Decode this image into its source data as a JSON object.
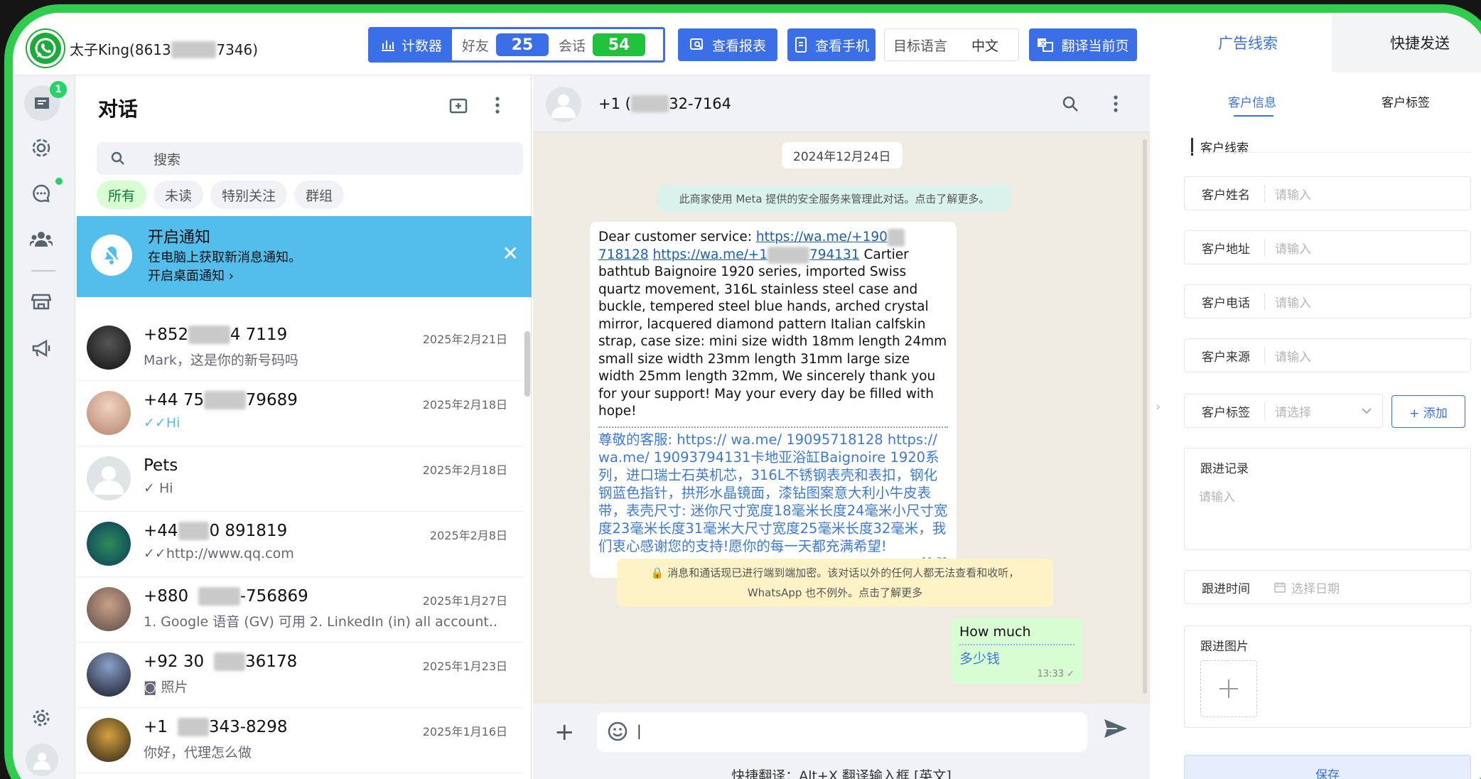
{
  "app": {
    "account": "太子King(8613",
    "account_suffix": "7346)"
  },
  "toolbar": {
    "counter_label": "计数器",
    "friends_label": "好友",
    "friends_count": "25",
    "sessions_label": "会话",
    "sessions_count": "54",
    "report_label": "查看报表",
    "phone_label": "查看手机",
    "target_lang_label": "目标语言",
    "target_lang_value": "中文",
    "translate_label": "翻译当前页"
  },
  "rail": {
    "badge": "1"
  },
  "list": {
    "title": "对话",
    "search_placeholder": "搜索",
    "filters": [
      "所有",
      "未读",
      "特别关注",
      "群组"
    ],
    "notify": {
      "title": "开启通知",
      "line1": "在电脑上获取新消息通知。",
      "line2": "开启桌面通知 ›"
    },
    "chats": [
      {
        "name_a": "+852",
        "name_b": "4 7119",
        "date": "2025年2月21日",
        "preview": "Mark，这是你的新号码吗"
      },
      {
        "name_a": "+44 75",
        "name_b": "79689",
        "date": "2025年2月18日",
        "preview": "✓✓Hi"
      },
      {
        "name_a": "Pets",
        "name_b": "",
        "date": "2025年2月18日",
        "preview": "✓ Hi"
      },
      {
        "name_a": "+44",
        "name_b": "0 891819",
        "date": "2025年2月8日",
        "preview": "✓✓http://www.qq.com"
      },
      {
        "name_a": "+880",
        "name_b": "-756869",
        "date": "2025年1月27日",
        "preview": "1. Google 语音 (GV) 可用 2.  LinkedIn (in) all account..."
      },
      {
        "name_a": "+92 30",
        "name_b": "36178",
        "date": "2025年1月23日",
        "preview": "◙ 照片"
      },
      {
        "name_a": "+1",
        "name_b": "343-8298",
        "date": "2025年1月16日",
        "preview": "你好，代理怎么做"
      }
    ]
  },
  "conversation": {
    "contact_a": "+1 (",
    "contact_b": "32-7164",
    "date": "2024年12月24日",
    "meta_notice": "此商家使用 Meta 提供的安全服务来管理此对话。点击了解更多。",
    "incoming": {
      "prefix": "Dear customer service: ",
      "link1_a": "https://wa.me/+190",
      "link1_b": "718128",
      "link2_a": "https://wa.me/+1",
      "link2_b": "794131",
      "body": " Cartier bathtub Baignoire 1920 series, imported Swiss quartz movement, 316L stainless steel case and buckle, tempered steel blue hands, arched crystal mirror, lacquered diamond pattern Italian calfskin strap, case size: mini size width 18mm length 24mm small size width 23mm length 31mm large size width 25mm length 32mm, We sincerely thank you for your support! May your every day be filled with hope!",
      "translation": "尊敬的客服: https:// wa.me/ 19095718128 https:// wa.me/ 19093794131卡地亚浴缸Baignoire 1920系列，进口瑞士石英机芯，316L不锈钢表壳和表扣，钢化钢蓝色指针，拱形水晶镜面，漆钻图案意大利小牛皮表带，表壳尺寸: 迷你尺寸宽度18毫米长度24毫米小尺寸宽度23毫米长度31毫米大尺寸宽度25毫米长度32毫米，我们衷心感谢您的支持!愿你的每一天都充满希望!",
      "time": "11:31"
    },
    "encryption_notice_1": "🔒 消息和通话现已进行端到端加密。该对话以外的任何人都无法查看和收听，",
    "encryption_notice_2": "WhatsApp 也不例外。点击了解更多",
    "outgoing": {
      "text": "How much",
      "translation": "多少钱",
      "time": "13:33 ✓"
    },
    "composer_value": "|",
    "hint": "快捷翻译：Alt+X 翻译输入框 [英文]"
  },
  "panel": {
    "tab_leads": "广告线索",
    "tab_quick": "快捷发送",
    "sub_info": "客户信息",
    "sub_tags": "客户标签",
    "section": "客户线索",
    "fields": [
      {
        "label": "客户姓名",
        "placeholder": "请输入"
      },
      {
        "label": "客户地址",
        "placeholder": "请输入"
      },
      {
        "label": "客户电话",
        "placeholder": "请输入"
      },
      {
        "label": "客户来源",
        "placeholder": "请输入"
      }
    ],
    "tag_label": "客户标签",
    "tag_placeholder": "请选择",
    "add_label": "+ 添加",
    "record_label": "跟进记录",
    "record_placeholder": "请输入",
    "time_label": "跟进时间",
    "time_placeholder": "选择日期",
    "image_label": "跟进图片",
    "save_label": "保存"
  },
  "colors": {
    "brand_green": "#1aab3a",
    "accent_blue": "#3b6fe8",
    "notify_blue": "#53bdeb"
  }
}
